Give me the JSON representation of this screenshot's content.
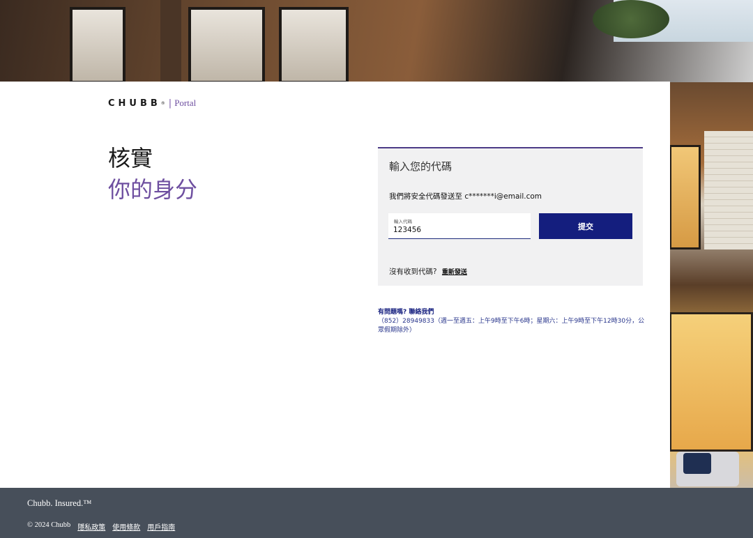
{
  "brand": {
    "name": "CHUBB",
    "registered": "®",
    "separator": "|",
    "product": "Portal"
  },
  "heading": {
    "line1": "核實",
    "line2": "你的身分"
  },
  "verify_panel": {
    "title": "輸入您的代碼",
    "notice": "我們將安全代碼發送至 c*******i@email.com",
    "code_label": "輸入代碼",
    "code_value": "123456",
    "submit_label": "提交",
    "resend_prompt": "沒有收到代碼?",
    "resend_link": "重新發送"
  },
  "help": {
    "heading": "有問題嗎? 聯絡我們",
    "details": "（852）28949833（週一至週五：上午9時至下午6時；星期六：上午9時至下午12時30分，公眾假期除外）"
  },
  "footer": {
    "tagline": "Chubb. Insured.™",
    "copyright": "© 2024 Chubb",
    "links": [
      "隱私政策",
      "使用條款",
      "用戶指南"
    ]
  },
  "colors": {
    "accent_purple": "#6e4fa0",
    "primary_navy": "#141e7e",
    "footer_bg": "#474f5a",
    "panel_bg": "#f1f1f2"
  }
}
